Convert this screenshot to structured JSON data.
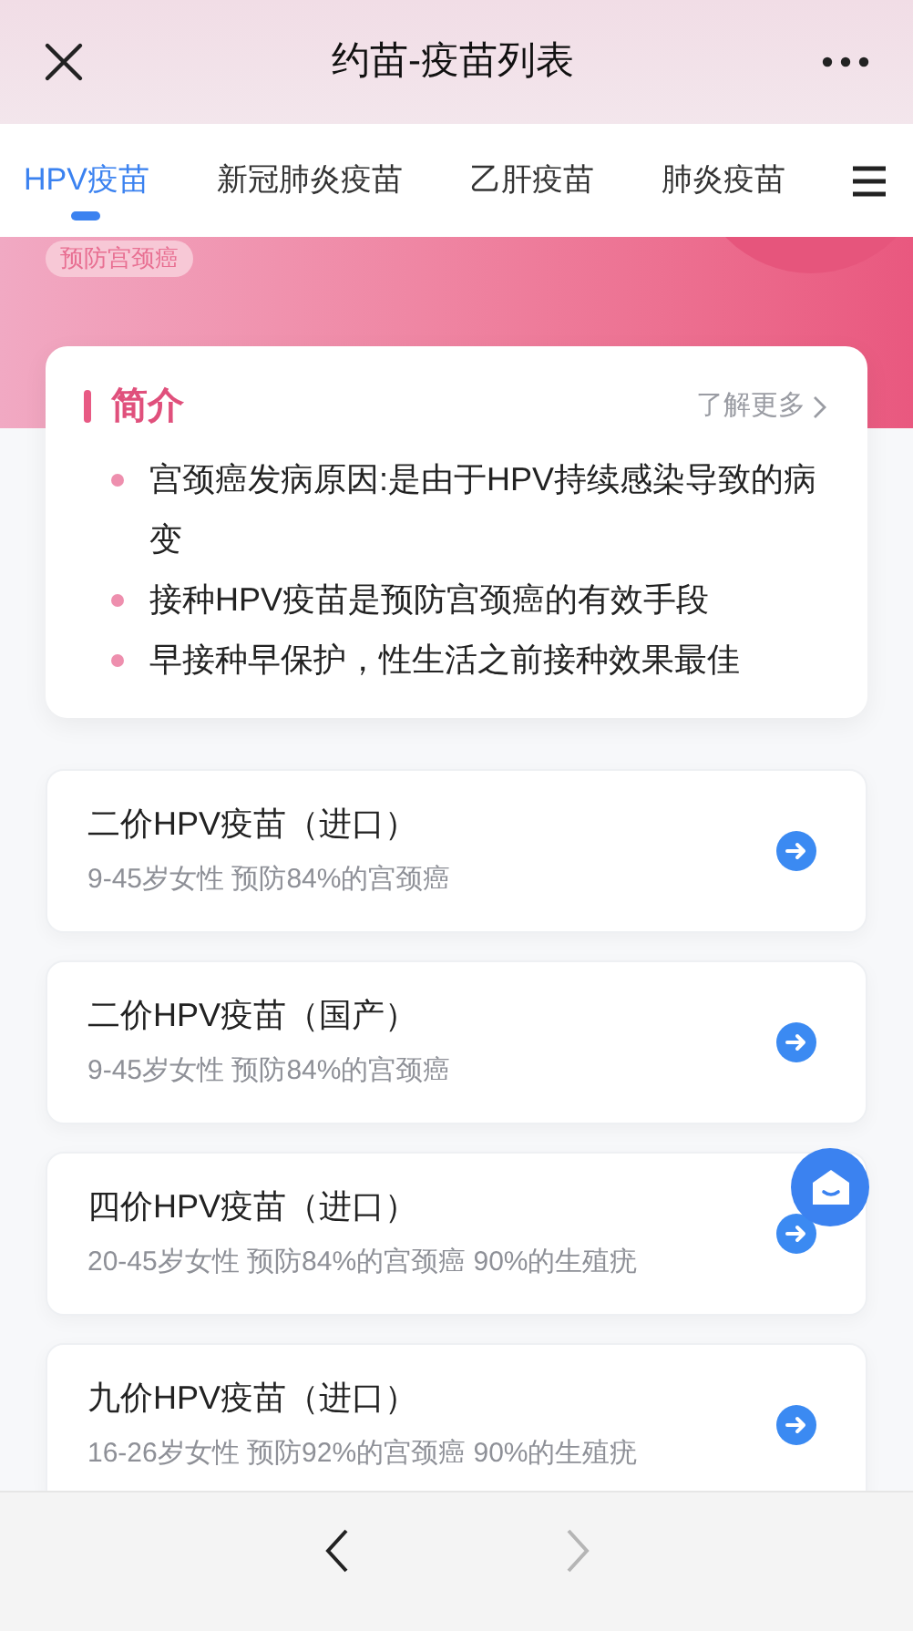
{
  "header": {
    "title": "约苗-疫苗列表"
  },
  "tabs": [
    {
      "label": "HPV疫苗",
      "selected": true
    },
    {
      "label": "新冠肺炎疫苗",
      "selected": false
    },
    {
      "label": "乙肝疫苗",
      "selected": false
    },
    {
      "label": "肺炎疫苗",
      "selected": false
    }
  ],
  "hero": {
    "tag": "预防宫颈癌"
  },
  "intro": {
    "title": "简介",
    "more": "了解更多",
    "bullets": [
      "宫颈癌发病原因:是由于HPV持续感染导致的病变",
      "接种HPV疫苗是预防宫颈癌的有效手段",
      "早接种早保护，性生活之前接种效果最佳"
    ]
  },
  "vaccines": [
    {
      "name": "二价HPV疫苗（进口）",
      "desc": "9-45岁女性 预防84%的宫颈癌"
    },
    {
      "name": "二价HPV疫苗（国产）",
      "desc": "9-45岁女性 预防84%的宫颈癌"
    },
    {
      "name": "四价HPV疫苗（进口）",
      "desc": "20-45岁女性 预防84%的宫颈癌 90%的生殖疣"
    },
    {
      "name": "九价HPV疫苗（进口）",
      "desc": "16-26岁女性 预防92%的宫颈癌 90%的生殖疣"
    }
  ],
  "browser_nav": {
    "back_disabled": false,
    "forward_disabled": true
  }
}
